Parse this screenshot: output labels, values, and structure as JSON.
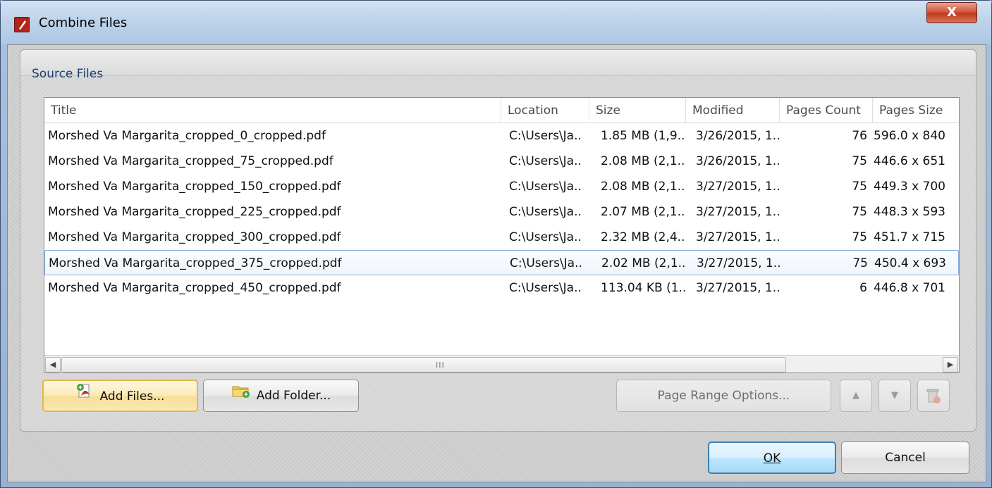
{
  "window": {
    "title": "Combine Files",
    "close_label": "X"
  },
  "source_files": {
    "group_title": "Source Files",
    "columns": [
      "Title",
      "Location",
      "Size",
      "Modified",
      "Pages Count",
      "Pages Size"
    ],
    "rows": [
      {
        "title": "Morshed Va Margarita_cropped_0_cropped.pdf",
        "location": "C:\\Users\\Ja..",
        "size": "1.85 MB (1,9..",
        "modified": "3/26/2015, 1..",
        "pages_count": "76",
        "pages_size": "596.0 x 840"
      },
      {
        "title": "Morshed Va Margarita_cropped_75_cropped.pdf",
        "location": "C:\\Users\\Ja..",
        "size": "2.08 MB (2,1..",
        "modified": "3/26/2015, 1..",
        "pages_count": "75",
        "pages_size": "446.6 x 651"
      },
      {
        "title": "Morshed Va Margarita_cropped_150_cropped.pdf",
        "location": "C:\\Users\\Ja..",
        "size": "2.08 MB (2,1..",
        "modified": "3/27/2015, 1..",
        "pages_count": "75",
        "pages_size": "449.3 x 700"
      },
      {
        "title": "Morshed Va Margarita_cropped_225_cropped.pdf",
        "location": "C:\\Users\\Ja..",
        "size": "2.07 MB (2,1..",
        "modified": "3/27/2015, 1..",
        "pages_count": "75",
        "pages_size": "448.3 x 593"
      },
      {
        "title": "Morshed Va Margarita_cropped_300_cropped.pdf",
        "location": "C:\\Users\\Ja..",
        "size": "2.32 MB (2,4..",
        "modified": "3/27/2015, 1..",
        "pages_count": "75",
        "pages_size": "451.7 x 715"
      },
      {
        "title": "Morshed Va Margarita_cropped_375_cropped.pdf",
        "location": "C:\\Users\\Ja..",
        "size": "2.02 MB (2,1..",
        "modified": "3/27/2015, 1..",
        "pages_count": "75",
        "pages_size": "450.4 x 693",
        "selected": true
      },
      {
        "title": "Morshed Va Margarita_cropped_450_cropped.pdf",
        "location": "C:\\Users\\Ja..",
        "size": "113.04 KB (1..",
        "modified": "3/27/2015, 1..",
        "pages_count": "6",
        "pages_size": "446.8 x 701"
      }
    ],
    "scroll_grip": "III"
  },
  "buttons": {
    "add_files": "Add Files...",
    "add_folder": "Add Folder...",
    "page_range_options": "Page Range Options...",
    "move_up_icon": "up-arrow-icon",
    "move_down_icon": "down-arrow-icon",
    "delete_icon": "trash-icon",
    "ok": "OK",
    "cancel": "Cancel"
  },
  "colors": {
    "selection_border": "#84acdd",
    "focus_border": "#e2b84a",
    "close_button": "#c13a1e",
    "app_icon": "#b2251c"
  }
}
